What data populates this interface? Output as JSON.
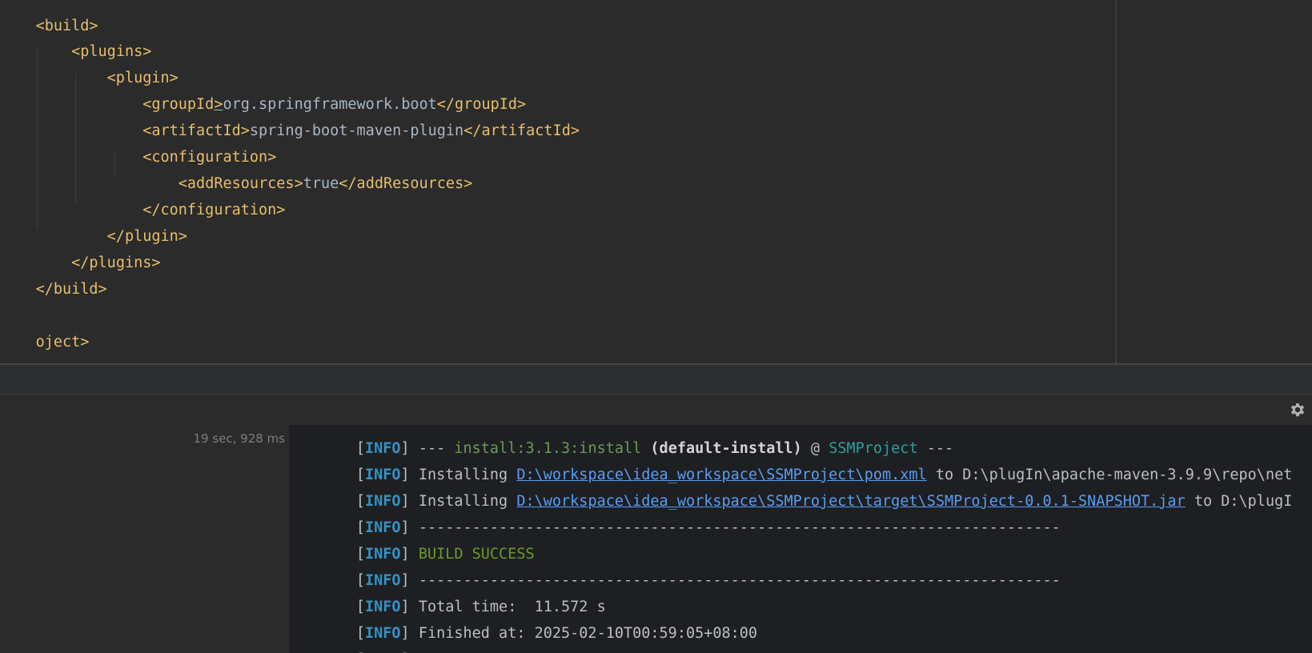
{
  "editor": {
    "lines": [
      {
        "indent": "",
        "tag": "<build>"
      },
      {
        "indent": "    ",
        "tag": "<plugins>"
      },
      {
        "indent": "        ",
        "tag": "<plugin>"
      },
      {
        "indent": "            ",
        "open": "<groupId",
        "caret": ">",
        "text": "org.springframework.boot",
        "close": "</groupId>"
      },
      {
        "indent": "            ",
        "open": "<artifactId>",
        "text": "spring-boot-maven-plugin",
        "close": "</artifactId>"
      },
      {
        "indent": "            ",
        "tag": "<configuration>"
      },
      {
        "indent": "                ",
        "open": "<addResources>",
        "text": "true",
        "close": "</addResources>"
      },
      {
        "indent": "            ",
        "tag": "</configuration>"
      },
      {
        "indent": "        ",
        "tag": "</plugin>"
      },
      {
        "indent": "    ",
        "tag": "</plugins>"
      },
      {
        "indent": "",
        "tag": "</build>"
      },
      {
        "indent": "",
        "tag": ""
      },
      {
        "indent": "",
        "tag": "oject>"
      }
    ]
  },
  "run_panel": {
    "elapsed": "19 sec, 928 ms",
    "settings_icon": "gear-icon",
    "console": {
      "level": "INFO",
      "line1": {
        "dashes_a": "--- ",
        "plugin": "install:3.1.3:install",
        "exec": "(default-install)",
        "at": " @ ",
        "project": "SSMProject",
        "dashes_b": " ---"
      },
      "line2": {
        "prefix": "Installing ",
        "link": "D:\\workspace\\idea_workspace\\SSMProject\\pom.xml",
        "suffix": " to D:\\plugIn\\apache-maven-3.9.9\\repo\\net"
      },
      "line3": {
        "prefix": "Installing ",
        "link": "D:\\workspace\\idea_workspace\\SSMProject\\target\\SSMProject-0.0.1-SNAPSHOT.jar",
        "suffix": " to D:\\plugI"
      },
      "separator": "------------------------------------------------------------------------",
      "build_success": "BUILD SUCCESS",
      "total_time": "Total time:  11.572 s",
      "finished_at": "Finished at: 2025-02-10T00:59:05+08:00"
    }
  },
  "colors": {
    "editor_bg": "#2b2b2b",
    "console_bg": "#1e1f22",
    "xml_tag": "#e8bf6a",
    "info": "#3592c4",
    "success": "#6a9a2e",
    "link": "#589df6"
  }
}
